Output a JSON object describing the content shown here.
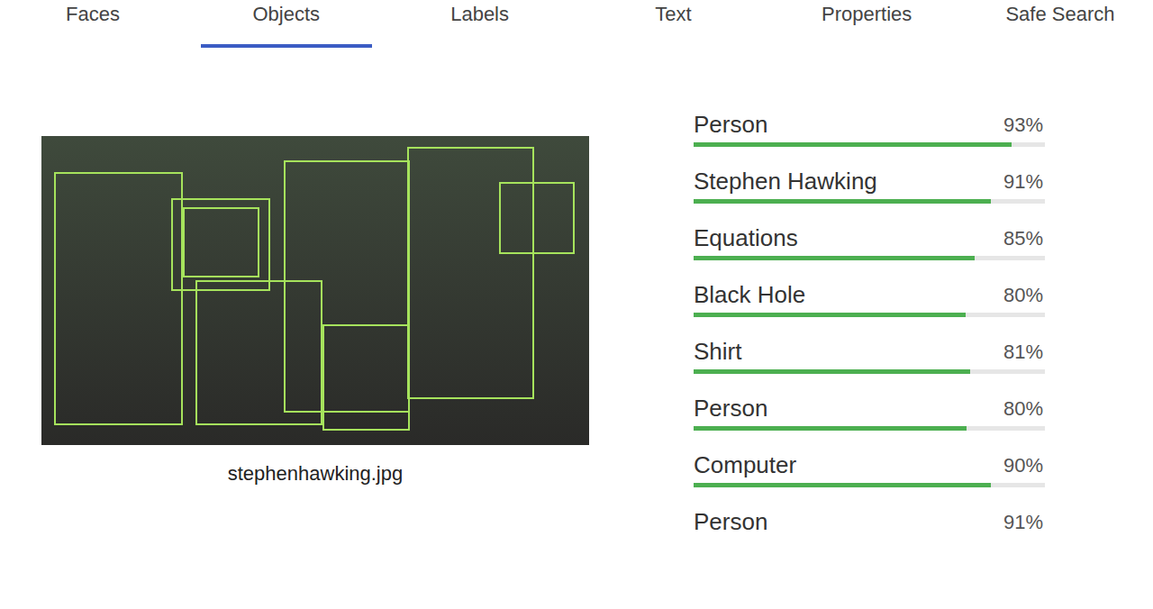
{
  "tabs": [
    {
      "label": "Faces",
      "selected": false
    },
    {
      "label": "Objects",
      "selected": true
    },
    {
      "label": "Labels",
      "selected": false
    },
    {
      "label": "Text",
      "selected": false
    },
    {
      "label": "Properties",
      "selected": false
    },
    {
      "label": "Safe Search",
      "selected": false
    }
  ],
  "image": {
    "caption": "stephenhawking.jpg"
  },
  "results": [
    {
      "label": "Person",
      "score": "93%",
      "level": 0.905
    },
    {
      "label": "Stephen Hawking",
      "score": "91%",
      "level": 0.846
    },
    {
      "label": "Equations",
      "score": "85%",
      "level": 0.8
    },
    {
      "label": "Black Hole",
      "score": "80%",
      "level": 0.774
    },
    {
      "label": "Shirt",
      "score": "81%",
      "level": 0.787
    },
    {
      "label": "Person",
      "score": "80%",
      "level": 0.777
    },
    {
      "label": "Computer",
      "score": "90%",
      "level": 0.846
    },
    {
      "label": "Person",
      "score": "91%"
    }
  ]
}
